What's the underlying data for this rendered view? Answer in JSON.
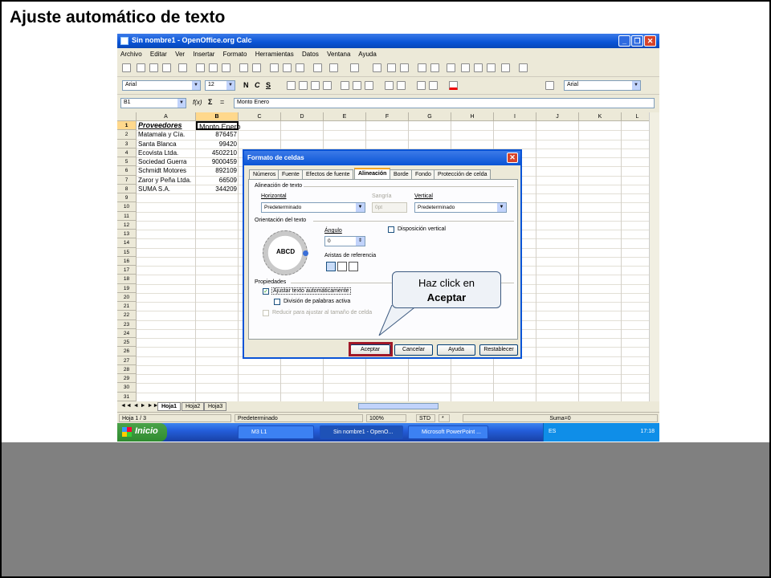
{
  "slide": {
    "title": "Ajuste automático de texto"
  },
  "window": {
    "title": "Sin nombre1 - OpenOffice.org Calc"
  },
  "menu": [
    "Archivo",
    "Editar",
    "Ver",
    "Insertar",
    "Formato",
    "Herramientas",
    "Datos",
    "Ventana",
    "Ayuda"
  ],
  "format_bar": {
    "font": "Arial",
    "size": "12",
    "bold": "N",
    "italic": "C",
    "underline": "S",
    "font_right": "Arial"
  },
  "formula_bar": {
    "cell_ref": "B1",
    "fx": "f(x)",
    "sigma": "Σ",
    "eq": "=",
    "content": "Monto Enero"
  },
  "columns": [
    "A",
    "B",
    "C",
    "D",
    "E",
    "F",
    "G",
    "H",
    "I",
    "J",
    "K",
    "L"
  ],
  "rows": [
    "1",
    "2",
    "3",
    "4",
    "5",
    "6",
    "7",
    "8",
    "9",
    "10",
    "11",
    "12",
    "13",
    "14",
    "15",
    "16",
    "17",
    "18",
    "19",
    "20",
    "21",
    "22",
    "23",
    "24",
    "25",
    "26",
    "27",
    "28",
    "29",
    "30",
    "31"
  ],
  "table": {
    "header": [
      "Proveedores",
      "Monto Enero"
    ],
    "names": [
      "Matamala y Cía.",
      "Santa Blanca",
      "Ecovista Ltda.",
      "Sociedad Guerra",
      "Schmidt Motores",
      "Zaror y Peña Ltda.",
      "SUMA S.A."
    ],
    "values": [
      "876457",
      "99420",
      "4502210",
      "9000459",
      "892109",
      "66509",
      "344209"
    ]
  },
  "sheet_tabs": [
    "Hoja1",
    "Hoja2",
    "Hoja3"
  ],
  "status": {
    "sheet": "Hoja 1 / 3",
    "style": "Predeterminado",
    "zoom": "100%",
    "mode": "STD",
    "star": "*",
    "sum": "Suma=0"
  },
  "taskbar": {
    "start": "Inicio",
    "items": [
      "M3 L1",
      "Sin nombre1 - OpenO...",
      "Microsoft PowerPoint ..."
    ],
    "lang": "ES",
    "clock": "17:18"
  },
  "dialog": {
    "title": "Formato de celdas",
    "tabs": [
      "Números",
      "Fuente",
      "Efectos de fuente",
      "Alineación",
      "Borde",
      "Fondo",
      "Protección de celda"
    ],
    "align_section": "Alineación de texto",
    "horizontal_label": "Horizontal",
    "horizontal_value": "Predeterminado",
    "indent_label": "Sangría",
    "indent_value": "0pt",
    "vertical_label": "Vertical",
    "vertical_value": "Predeterminado",
    "orient_section": "Orientación del texto",
    "dial_text": "ABCD",
    "angle_label": "Ángulo",
    "angle_value": "0",
    "ref_label": "Aristas de referencia",
    "vertical_stack": "Disposición vertical",
    "props_section": "Propiedades",
    "wrap": "Ajustar texto automáticamente",
    "hyphen": "División de palabras activa",
    "shrink": "Reducir para ajustar al tamaño de celda",
    "buttons": {
      "ok": "Aceptar",
      "cancel": "Cancelar",
      "help": "Ayuda",
      "reset": "Restablecer"
    }
  },
  "callout": {
    "line1": "Haz click en",
    "line2": "Aceptar"
  }
}
